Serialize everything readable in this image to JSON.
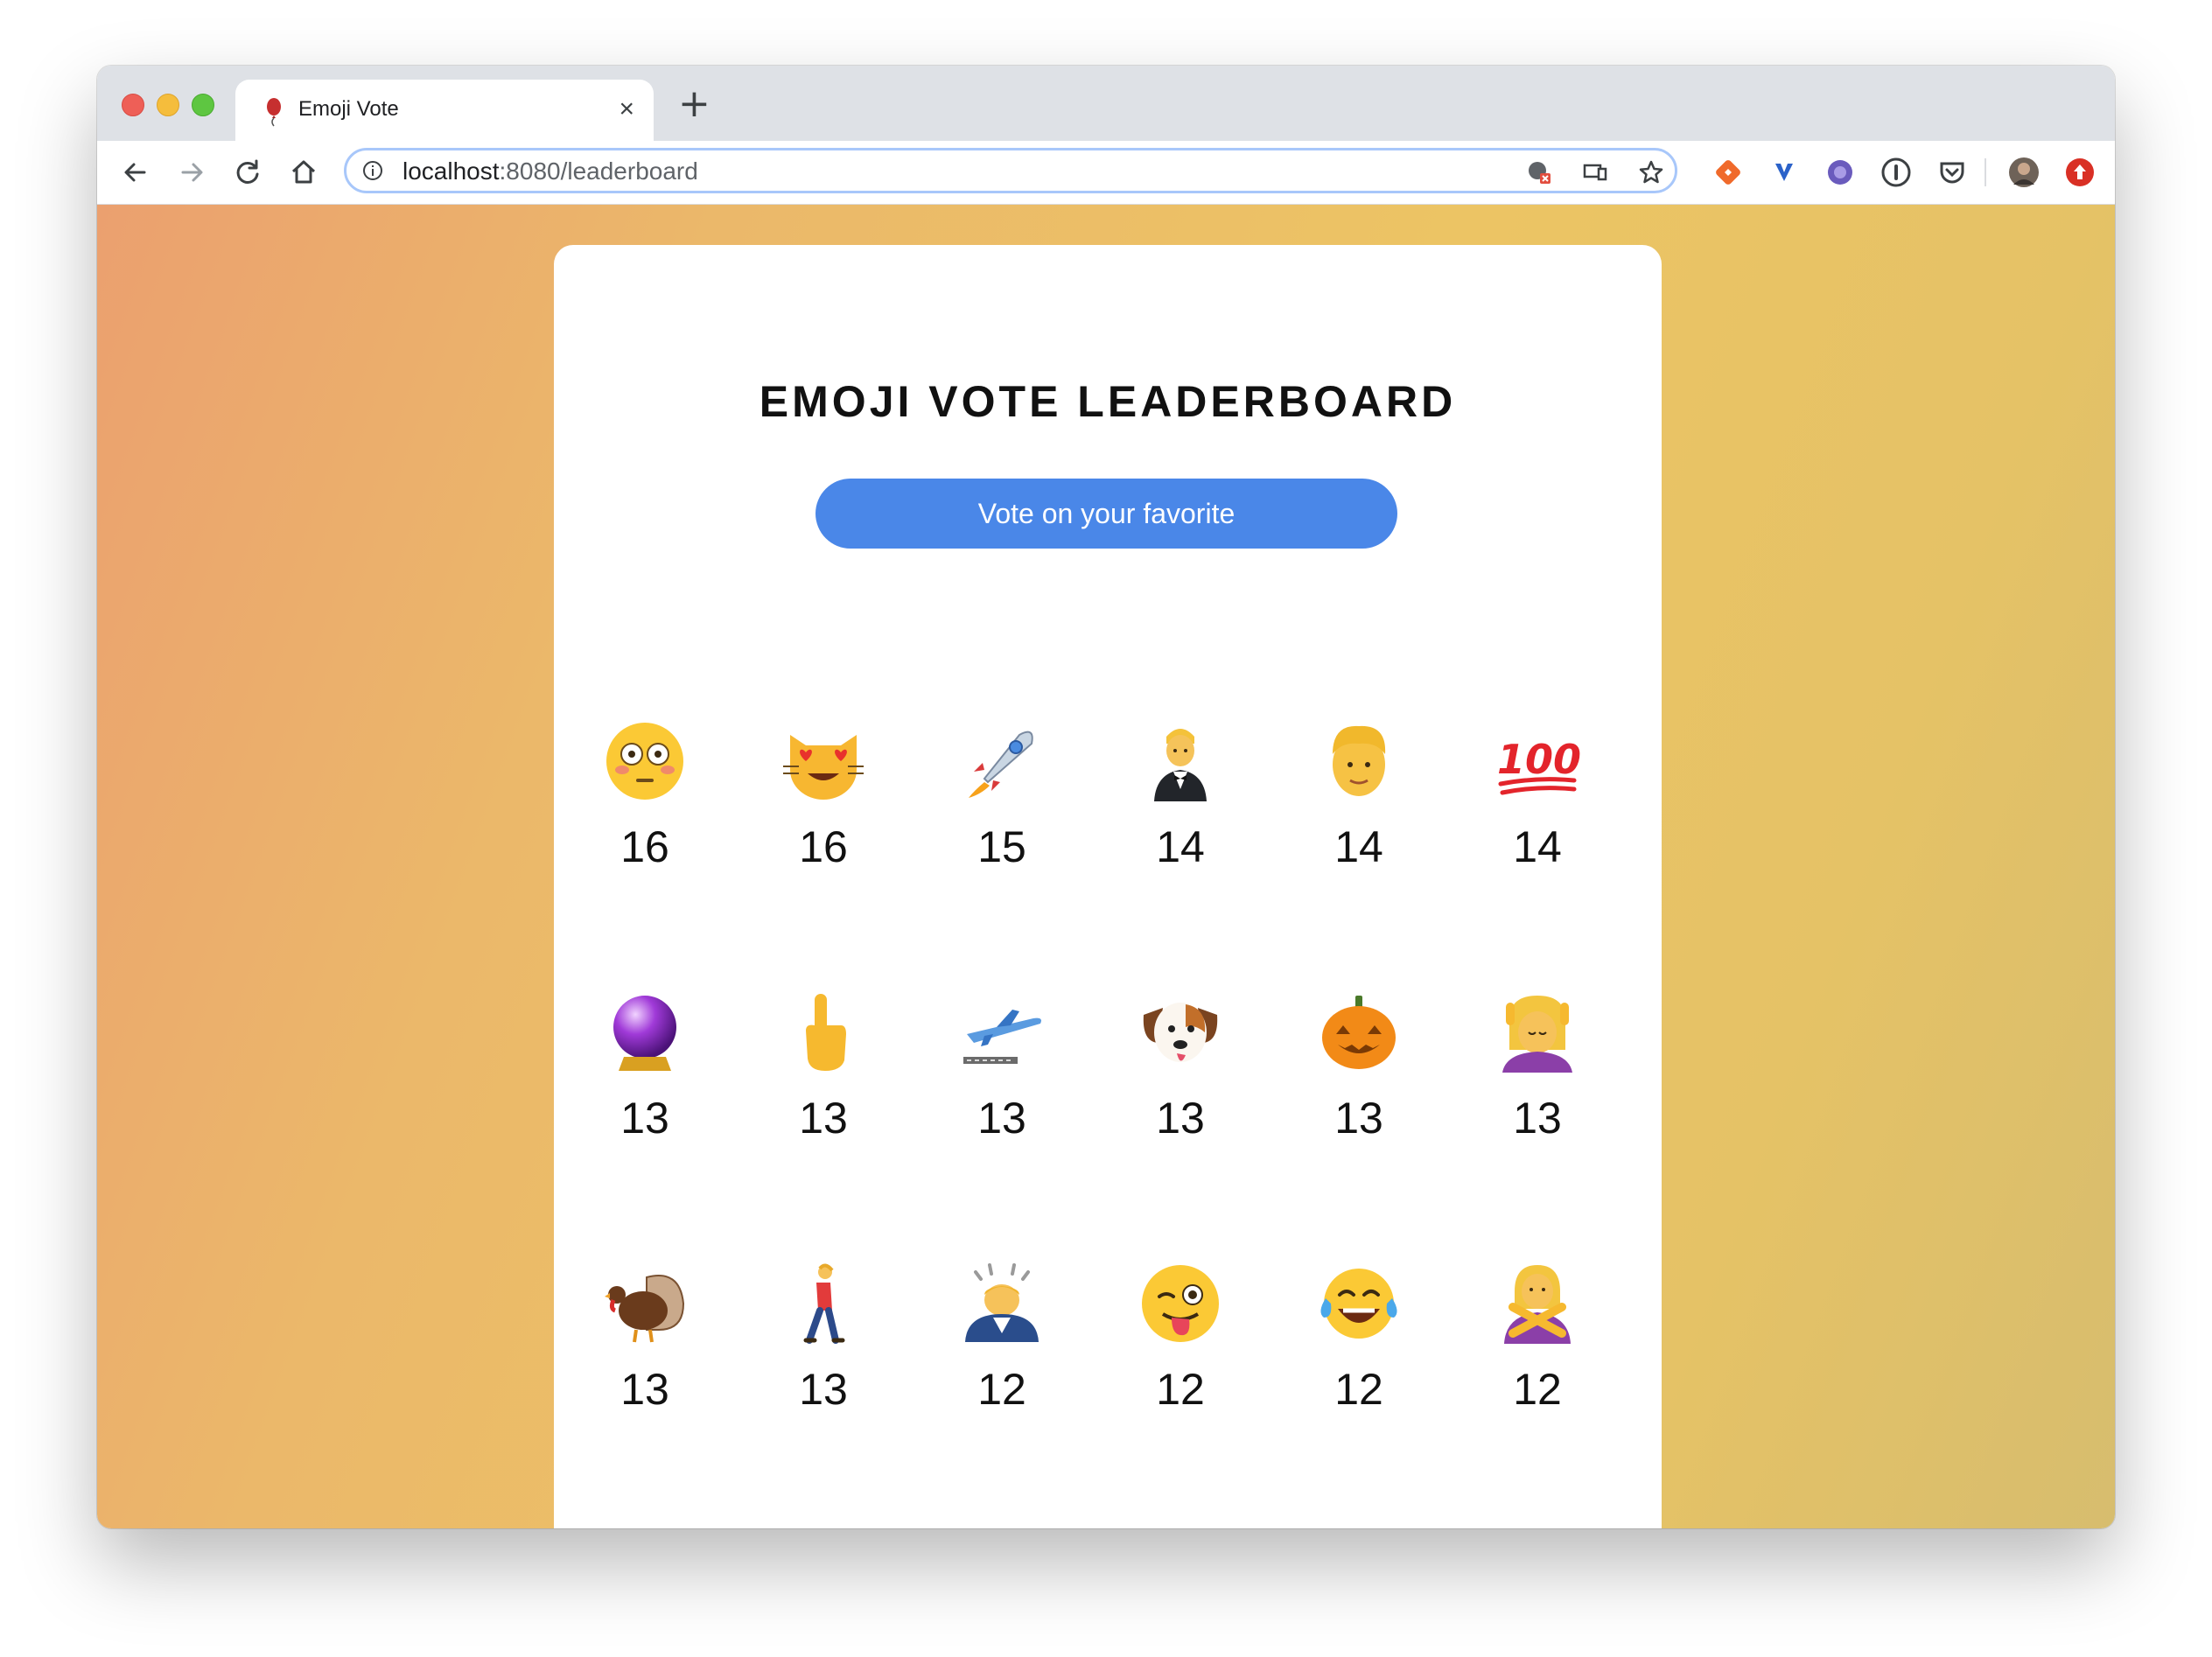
{
  "browser": {
    "tab_title": "Emoji Vote",
    "tab_close": "×",
    "new_tab": "+",
    "url_host": "localhost",
    "url_rest": ":8080/leaderboard"
  },
  "page": {
    "title": "EMOJI VOTE LEADERBOARD",
    "vote_button": "Vote on your favorite"
  },
  "leaderboard": [
    {
      "emoji": "flushed-face",
      "count": "16"
    },
    {
      "emoji": "heart-eyes-cat",
      "count": "16"
    },
    {
      "emoji": "rocket",
      "count": "15"
    },
    {
      "emoji": "man-in-tuxedo",
      "count": "14"
    },
    {
      "emoji": "man",
      "count": "14"
    },
    {
      "emoji": "hundred-points",
      "count": "14"
    },
    {
      "emoji": "crystal-ball",
      "count": "13"
    },
    {
      "emoji": "pointing-up",
      "count": "13"
    },
    {
      "emoji": "airplane-departure",
      "count": "13"
    },
    {
      "emoji": "dog-face",
      "count": "13"
    },
    {
      "emoji": "jack-o-lantern",
      "count": "13"
    },
    {
      "emoji": "person-getting-massage",
      "count": "13"
    },
    {
      "emoji": "turkey",
      "count": "13"
    },
    {
      "emoji": "person-walking",
      "count": "13"
    },
    {
      "emoji": "person-bowing",
      "count": "12"
    },
    {
      "emoji": "winking-face-with-tongue",
      "count": "12"
    },
    {
      "emoji": "face-with-tears-of-joy",
      "count": "12"
    },
    {
      "emoji": "person-gesturing-no",
      "count": "12"
    }
  ],
  "colors": {
    "button": "#4a87e8",
    "gradient_start": "#eba06f",
    "gradient_end": "#d7bd6e"
  }
}
